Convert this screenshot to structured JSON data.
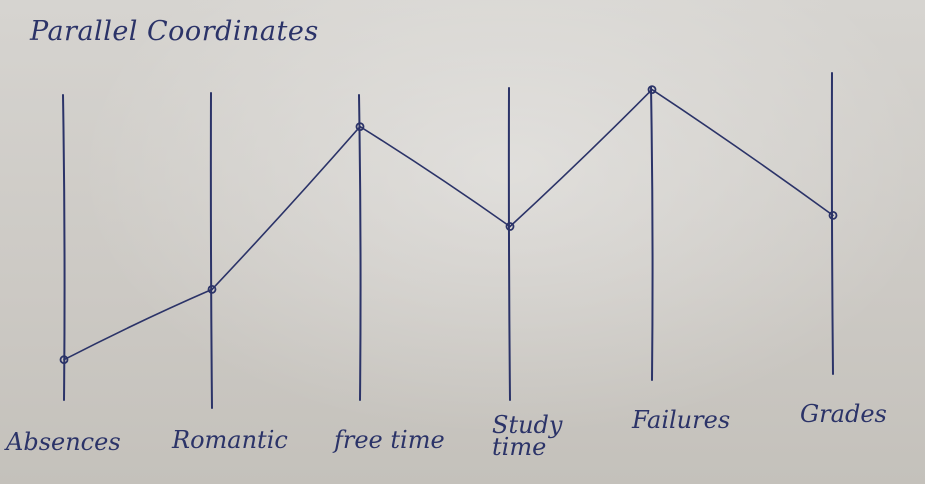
{
  "title": "Parallel Coordinates",
  "axes": [
    {
      "id": "absences",
      "label": "Absences",
      "value": 0.19
    },
    {
      "id": "romantic",
      "label": "Romantic",
      "value": 0.38
    },
    {
      "id": "free-time",
      "label": "free time",
      "value": 0.82
    },
    {
      "id": "study-time",
      "label": "Study time",
      "value": 0.55
    },
    {
      "id": "failures",
      "label": "Failures",
      "value": 0.92
    },
    {
      "id": "grades",
      "label": "Grades",
      "value": 0.58
    }
  ],
  "colors": {
    "ink": "#2b3368",
    "paper": "#cfcdc9"
  }
}
